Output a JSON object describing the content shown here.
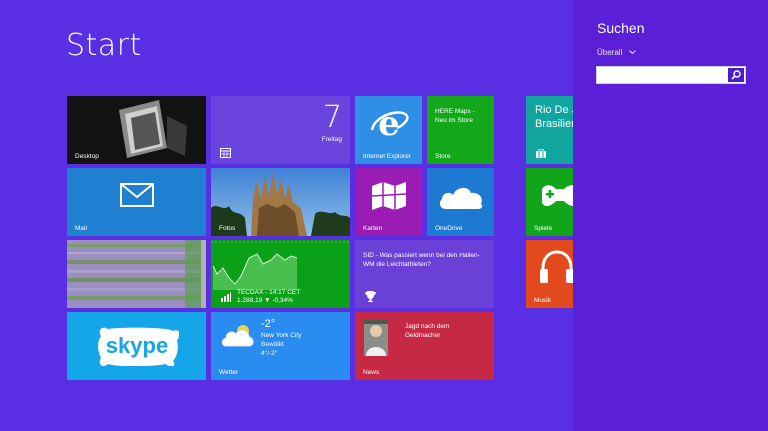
{
  "start": {
    "title": "Start"
  },
  "tiles": {
    "desktop": {
      "label": "Desktop"
    },
    "calendar": {
      "day_number": "7",
      "day_name": "Freitag"
    },
    "ie": {
      "label": "Internet Explorer"
    },
    "store": {
      "label": "Store",
      "text_line1": "HERE Maps -",
      "text_line2": "Neu im Store"
    },
    "rio": {
      "text_line1": "Rio De J",
      "text_line2": "Brasilien"
    },
    "mail": {
      "label": "Mail"
    },
    "photos": {
      "label": "Fotos"
    },
    "maps": {
      "label": "Karten"
    },
    "onedrive": {
      "label": "OneDrive"
    },
    "games": {
      "label": "Spiele"
    },
    "finance": {
      "index": "TECDAX - 14:17 CET",
      "value": "1.288,19 ▼ -0,34%"
    },
    "sport": {
      "headline": "SID - Was passiert wenn bei den Hallen-WM die Leichtathleten?"
    },
    "music": {
      "label": "Musik"
    },
    "skype": {
      "logo": "skype"
    },
    "weather": {
      "label": "Wetter",
      "temp": "-2°",
      "city": "New York City",
      "condition": "Bewölkt",
      "range": "4°/-2°"
    },
    "news": {
      "label": "News",
      "headline_line1": "Jagd nach dem",
      "headline_line2": "Geldmacher"
    }
  },
  "search": {
    "title": "Suchen",
    "scope": "Überall",
    "input_value": "",
    "input_placeholder": ""
  },
  "colors": {
    "background": "#5a2fe3",
    "search_pane": "#5a1fd6",
    "ie": "#2f8ee6",
    "store": "#13a81b",
    "mail": "#1f7fd1",
    "maps": "#9b1bb5",
    "onedrive": "#1e79d3",
    "games": "#11a51c",
    "finance": "#0aa118",
    "sport": "#6a40d7",
    "music": "#e2491c",
    "skype": "#14a6e8",
    "weather": "#2a8bf0",
    "news": "#c62944"
  }
}
